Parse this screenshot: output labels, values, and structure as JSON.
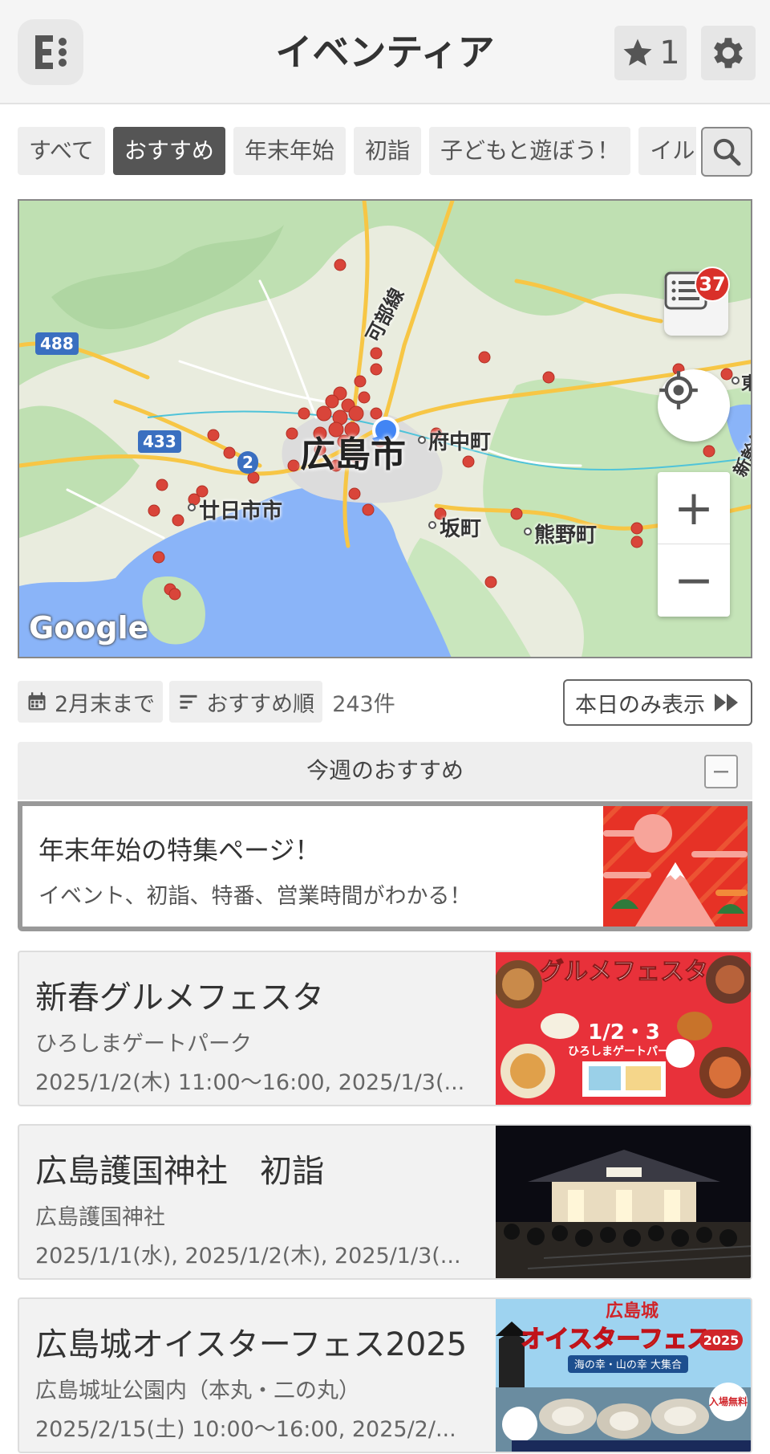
{
  "header": {
    "title": "イベンティア",
    "favorites_count": "1"
  },
  "tabs": [
    {
      "label": "すべて",
      "active": false
    },
    {
      "label": "おすすめ",
      "active": true
    },
    {
      "label": "年末年始",
      "active": false
    },
    {
      "label": "初詣",
      "active": false
    },
    {
      "label": "子どもと遊ぼう！",
      "active": false
    },
    {
      "label": "イルミ",
      "active": false
    }
  ],
  "map": {
    "city_label": "広島市",
    "places": {
      "hatsukaichi": "廿日市市",
      "fuchu": "府中町",
      "saka": "坂町",
      "kumano": "熊野町",
      "kabe_line": "可部線",
      "shinkansen": "新幹線",
      "east": "東"
    },
    "routes": [
      "488",
      "433",
      "2"
    ],
    "google": "Google",
    "list_badge_count": "37"
  },
  "filters": {
    "period": "2月末まで",
    "sort": "おすすめ順",
    "count": "243件",
    "today_only": "本日のみ表示"
  },
  "section": {
    "title": "今週のおすすめ"
  },
  "featured": {
    "title": "年末年始の特集ページ！",
    "subtitle": "イベント、初詣、特番、営業時間がわかる！"
  },
  "events": [
    {
      "title": "新春グルメフェスタ",
      "venue": "ひろしまゲートパーク",
      "dates": "2025/1/2(木) 11:00〜16:00, 2025/1/3(...",
      "poster_title": "グルメフェスタ",
      "poster_dates": "1/2・3",
      "poster_venue": "ひろしまゲートパーク"
    },
    {
      "title": "広島護国神社　初詣",
      "venue": "広島護国神社",
      "dates": "2025/1/1(水), 2025/1/2(木), 2025/1/3(..."
    },
    {
      "title": "広島城オイスターフェス2025",
      "venue": "広島城址公園内（本丸・二の丸）",
      "dates": "2025/2/15(土) 10:00〜16:00, 2025/2/...",
      "poster_top": "広島城",
      "poster_title": "オイスターフェス",
      "poster_year": "2025",
      "poster_sub": "海の幸・山の幸 大集合",
      "poster_free": "入場無料"
    }
  ],
  "colors": {
    "accent_dark": "#555555",
    "badge_red": "#d9302a",
    "marker_red": "#d9453a",
    "water": "#8ab4f8",
    "land_green": "#b9dcae"
  }
}
